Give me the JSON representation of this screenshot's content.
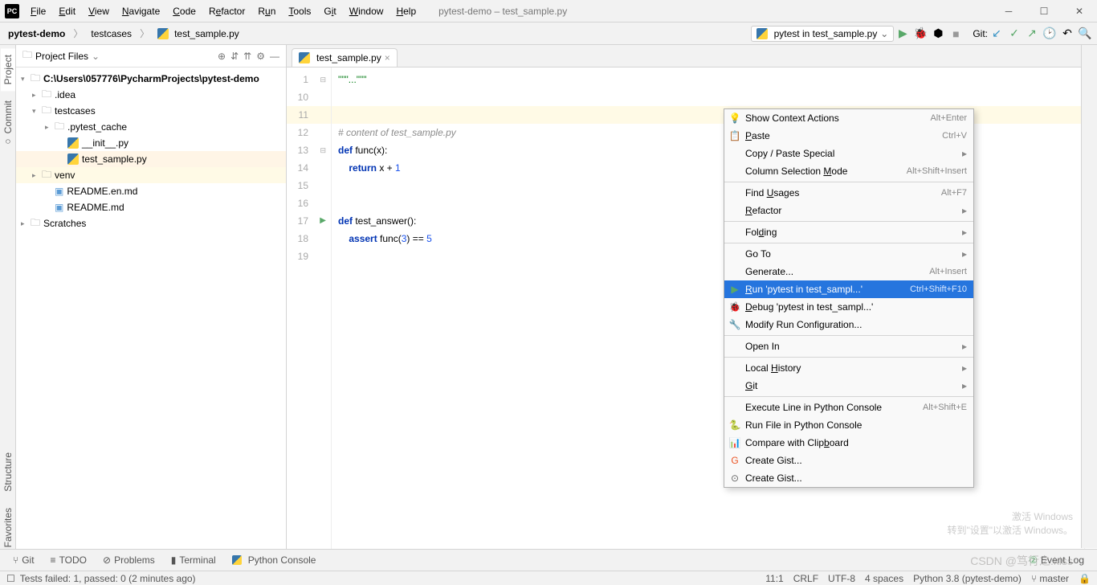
{
  "title": "pytest-demo – test_sample.py",
  "menus": [
    "File",
    "Edit",
    "View",
    "Navigate",
    "Code",
    "Refactor",
    "Run",
    "Tools",
    "Git",
    "Window",
    "Help"
  ],
  "menu_underlines": [
    0,
    0,
    0,
    0,
    0,
    1,
    1,
    0,
    1,
    0,
    0
  ],
  "breadcrumb": [
    "pytest-demo",
    "testcases",
    "test_sample.py"
  ],
  "run_config": "pytest in test_sample.py",
  "git_label": "Git:",
  "panel": {
    "title": "Project Files"
  },
  "tree": {
    "root": "C:\\Users\\057776\\PycharmProjects\\pytest-demo",
    "idea": ".idea",
    "testcases": "testcases",
    "pytest_cache": ".pytest_cache",
    "init": "__init__.py",
    "sample": "test_sample.py",
    "venv": "venv",
    "readme_en": "README.en.md",
    "readme": "README.md",
    "scratches": "Scratches"
  },
  "tab": "test_sample.py",
  "code": {
    "l1": "\"\"\"...\"\"\"",
    "l2": "",
    "l3": "",
    "l4": "# content of test_sample.py",
    "l5a": "def",
    "l5b": " func(x):",
    "l6a": "    ",
    "l6b": "return",
    "l6c": " x + ",
    "l6d": "1",
    "l7": "",
    "l8": "",
    "l9a": "def",
    "l9b": " test_answer():",
    "l10a": "    ",
    "l10b": "assert",
    "l10c": " func(",
    "l10d": "3",
    "l10e": ") == ",
    "l10f": "5",
    "l11": ""
  },
  "line_numbers": [
    "1",
    "10",
    "11",
    "12",
    "13",
    "14",
    "15",
    "16",
    "17",
    "18",
    "19"
  ],
  "context_menu": [
    {
      "icon": "💡",
      "label": "Show Context Actions",
      "short": "Alt+Enter"
    },
    {
      "icon": "📋",
      "label": "Paste",
      "short": "Ctrl+V",
      "u": 0
    },
    {
      "label": "Copy / Paste Special",
      "sub": "▸"
    },
    {
      "label": "Column Selection Mode",
      "short": "Alt+Shift+Insert",
      "u": 17
    },
    {
      "sep": true
    },
    {
      "label": "Find Usages",
      "short": "Alt+F7",
      "u": 5
    },
    {
      "label": "Refactor",
      "sub": "▸",
      "u": 0
    },
    {
      "sep": true
    },
    {
      "label": "Folding",
      "sub": "▸",
      "u": 3
    },
    {
      "sep": true
    },
    {
      "label": "Go To",
      "sub": "▸"
    },
    {
      "label": "Generate...",
      "short": "Alt+Insert"
    },
    {
      "icon": "▶",
      "label": "Run 'pytest in test_sampl...'",
      "short": "Ctrl+Shift+F10",
      "sel": true,
      "iconColor": "#59a869",
      "u": 0
    },
    {
      "icon": "🐞",
      "label": "Debug 'pytest in test_sampl...'",
      "u": 0
    },
    {
      "icon": "🔧",
      "label": "Modify Run Configuration..."
    },
    {
      "sep": true
    },
    {
      "label": "Open In",
      "sub": "▸"
    },
    {
      "sep": true
    },
    {
      "label": "Local History",
      "sub": "▸",
      "u": 6
    },
    {
      "label": "Git",
      "sub": "▸",
      "u": 0
    },
    {
      "sep": true
    },
    {
      "label": "Execute Line in Python Console",
      "short": "Alt+Shift+E"
    },
    {
      "icon": "🐍",
      "label": "Run File in Python Console"
    },
    {
      "icon": "📊",
      "label": "Compare with Clipboard",
      "u": 17
    },
    {
      "icon": "G",
      "label": "Create Gist...",
      "iconColor": "#eb5424"
    },
    {
      "icon": "⊙",
      "label": "Create Gist..."
    }
  ],
  "left_tabs": [
    "Project",
    "Commit",
    "Structure",
    "Favorites"
  ],
  "bottom_tools": [
    "Git",
    "TODO",
    "Problems",
    "Terminal",
    "Python Console"
  ],
  "event_log": "Event Log",
  "status": {
    "left": "Tests failed: 1, passed: 0 (2 minutes ago)",
    "pos": "11:1",
    "eol": "CRLF",
    "enc": "UTF-8",
    "indent": "4 spaces",
    "interp": "Python 3.8 (pytest-demo)",
    "branch": "master"
  },
  "watermark": {
    "t1": "激活 Windows",
    "t2": "转到\"设置\"以激活 Windows。"
  },
  "csdn": "CSDN @笃行之.kiss"
}
